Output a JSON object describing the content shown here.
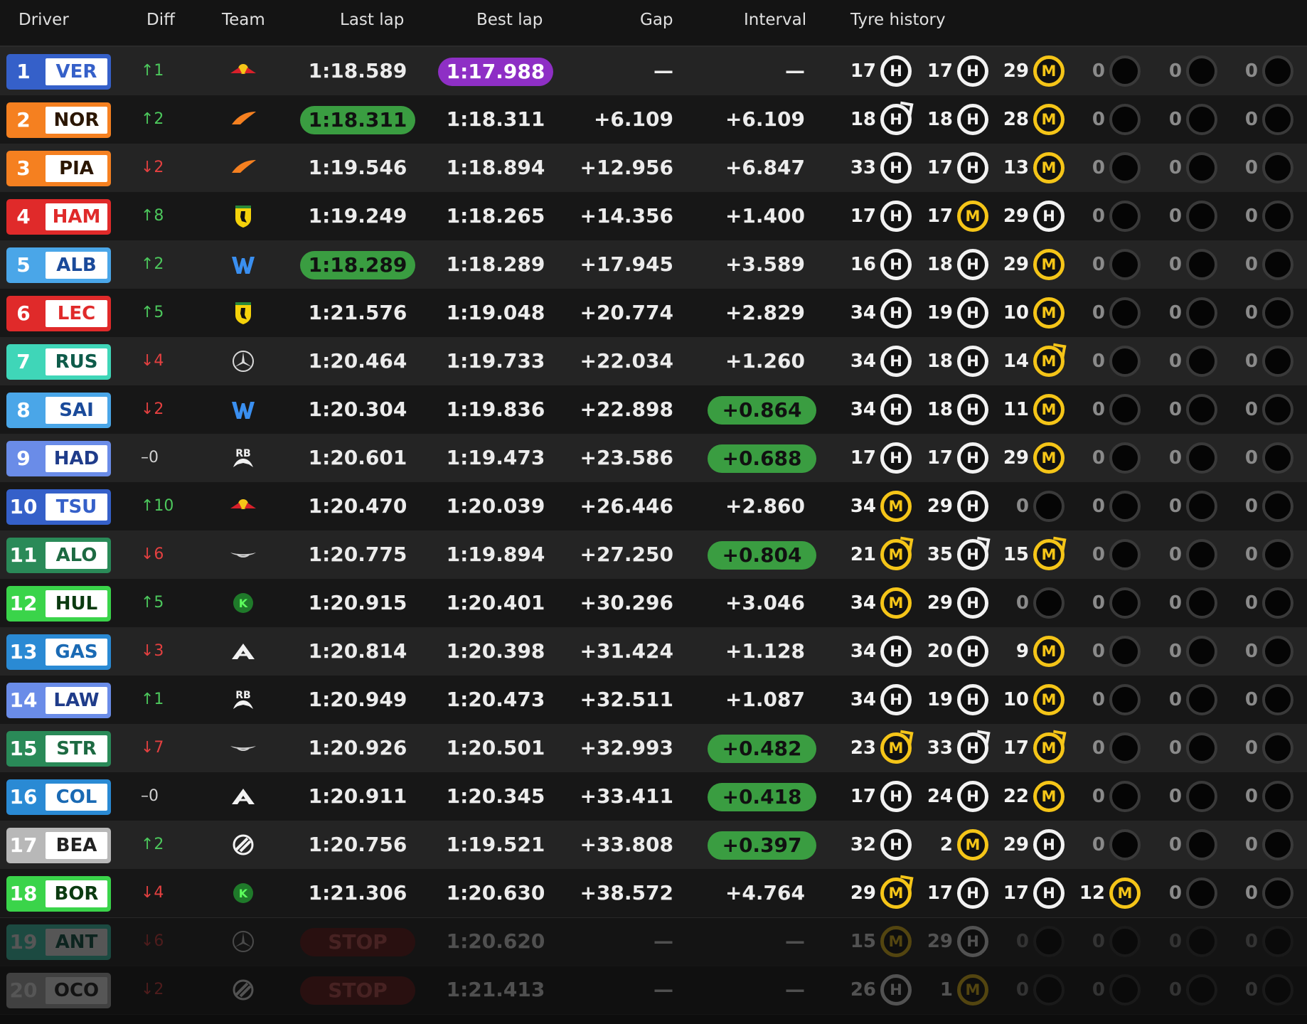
{
  "headers": {
    "driver": "Driver",
    "diff": "Diff",
    "team": "Team",
    "last_lap": "Last lap",
    "best_lap": "Best lap",
    "gap": "Gap",
    "interval": "Interval",
    "tyres": "Tyre history"
  },
  "colors": {
    "purple": "#8e2fc5",
    "green": "#3a9d41",
    "stop": "#6b1a18",
    "up": "#4cc75c",
    "down": "#e44040"
  },
  "rows": [
    {
      "pos": "1",
      "abbr": "VER",
      "team_color": "#3560c9",
      "abbr_color": "#3560c9",
      "diff": "↑1",
      "dir": "up",
      "team_icon": "redbull-icon",
      "last": "1:18.589",
      "last_hl": "",
      "best": "1:17.988",
      "best_hl": "purple",
      "gap": "—",
      "interval": "—",
      "int_hl": "",
      "tyres": [
        [
          "17",
          "H",
          ""
        ],
        [
          "17",
          "H",
          ""
        ],
        [
          "29",
          "M",
          ""
        ],
        [
          "0",
          "E",
          ""
        ],
        [
          "0",
          "E",
          ""
        ],
        [
          "0",
          "E",
          ""
        ]
      ]
    },
    {
      "pos": "2",
      "abbr": "NOR",
      "team_color": "#f58020",
      "abbr_color": "#2b1600",
      "diff": "↑2",
      "dir": "up",
      "team_icon": "mclaren-icon",
      "last": "1:18.311",
      "last_hl": "green",
      "best": "1:18.311",
      "best_hl": "",
      "gap": "+6.109",
      "interval": "+6.109",
      "int_hl": "",
      "tyres": [
        [
          "18",
          "H",
          "used"
        ],
        [
          "18",
          "H",
          ""
        ],
        [
          "28",
          "M",
          ""
        ],
        [
          "0",
          "E",
          ""
        ],
        [
          "0",
          "E",
          ""
        ],
        [
          "0",
          "E",
          ""
        ]
      ]
    },
    {
      "pos": "3",
      "abbr": "PIA",
      "team_color": "#f58020",
      "abbr_color": "#2b1600",
      "diff": "↓2",
      "dir": "down",
      "team_icon": "mclaren-icon",
      "last": "1:19.546",
      "last_hl": "",
      "best": "1:18.894",
      "best_hl": "",
      "gap": "+12.956",
      "interval": "+6.847",
      "int_hl": "",
      "tyres": [
        [
          "33",
          "H",
          ""
        ],
        [
          "17",
          "H",
          ""
        ],
        [
          "13",
          "M",
          ""
        ],
        [
          "0",
          "E",
          ""
        ],
        [
          "0",
          "E",
          ""
        ],
        [
          "0",
          "E",
          ""
        ]
      ]
    },
    {
      "pos": "4",
      "abbr": "HAM",
      "team_color": "#e02a2a",
      "abbr_color": "#e02a2a",
      "diff": "↑8",
      "dir": "up",
      "team_icon": "ferrari-icon",
      "last": "1:19.249",
      "last_hl": "",
      "best": "1:18.265",
      "best_hl": "",
      "gap": "+14.356",
      "interval": "+1.400",
      "int_hl": "",
      "tyres": [
        [
          "17",
          "H",
          ""
        ],
        [
          "17",
          "M",
          ""
        ],
        [
          "29",
          "H",
          ""
        ],
        [
          "0",
          "E",
          ""
        ],
        [
          "0",
          "E",
          ""
        ],
        [
          "0",
          "E",
          ""
        ]
      ]
    },
    {
      "pos": "5",
      "abbr": "ALB",
      "team_color": "#4aa6e8",
      "abbr_color": "#1a4a9a",
      "diff": "↑2",
      "dir": "up",
      "team_icon": "williams-icon",
      "last": "1:18.289",
      "last_hl": "green",
      "best": "1:18.289",
      "best_hl": "",
      "gap": "+17.945",
      "interval": "+3.589",
      "int_hl": "",
      "tyres": [
        [
          "16",
          "H",
          ""
        ],
        [
          "18",
          "H",
          ""
        ],
        [
          "29",
          "M",
          ""
        ],
        [
          "0",
          "E",
          ""
        ],
        [
          "0",
          "E",
          ""
        ],
        [
          "0",
          "E",
          ""
        ]
      ]
    },
    {
      "pos": "6",
      "abbr": "LEC",
      "team_color": "#e02a2a",
      "abbr_color": "#e02a2a",
      "diff": "↑5",
      "dir": "up",
      "team_icon": "ferrari-icon",
      "last": "1:21.576",
      "last_hl": "",
      "best": "1:19.048",
      "best_hl": "",
      "gap": "+20.774",
      "interval": "+2.829",
      "int_hl": "",
      "tyres": [
        [
          "34",
          "H",
          ""
        ],
        [
          "19",
          "H",
          ""
        ],
        [
          "10",
          "M",
          ""
        ],
        [
          "0",
          "E",
          ""
        ],
        [
          "0",
          "E",
          ""
        ],
        [
          "0",
          "E",
          ""
        ]
      ]
    },
    {
      "pos": "7",
      "abbr": "RUS",
      "team_color": "#3fd6b8",
      "abbr_color": "#0e5b4a",
      "diff": "↓4",
      "dir": "down",
      "team_icon": "mercedes-icon",
      "last": "1:20.464",
      "last_hl": "",
      "best": "1:19.733",
      "best_hl": "",
      "gap": "+22.034",
      "interval": "+1.260",
      "int_hl": "",
      "tyres": [
        [
          "34",
          "H",
          ""
        ],
        [
          "18",
          "H",
          ""
        ],
        [
          "14",
          "M",
          "used"
        ],
        [
          "0",
          "E",
          ""
        ],
        [
          "0",
          "E",
          ""
        ],
        [
          "0",
          "E",
          ""
        ]
      ]
    },
    {
      "pos": "8",
      "abbr": "SAI",
      "team_color": "#4aa6e8",
      "abbr_color": "#1a4a9a",
      "diff": "↓2",
      "dir": "down",
      "team_icon": "williams-icon",
      "last": "1:20.304",
      "last_hl": "",
      "best": "1:19.836",
      "best_hl": "",
      "gap": "+22.898",
      "interval": "+0.864",
      "int_hl": "green",
      "tyres": [
        [
          "34",
          "H",
          ""
        ],
        [
          "18",
          "H",
          ""
        ],
        [
          "11",
          "M",
          ""
        ],
        [
          "0",
          "E",
          ""
        ],
        [
          "0",
          "E",
          ""
        ],
        [
          "0",
          "E",
          ""
        ]
      ]
    },
    {
      "pos": "9",
      "abbr": "HAD",
      "team_color": "#6a8ce8",
      "abbr_color": "#1f3c8a",
      "diff": "–0",
      "dir": "flat",
      "team_icon": "racingbulls-icon",
      "last": "1:20.601",
      "last_hl": "",
      "best": "1:19.473",
      "best_hl": "",
      "gap": "+23.586",
      "interval": "+0.688",
      "int_hl": "green",
      "tyres": [
        [
          "17",
          "H",
          ""
        ],
        [
          "17",
          "H",
          ""
        ],
        [
          "29",
          "M",
          ""
        ],
        [
          "0",
          "E",
          ""
        ],
        [
          "0",
          "E",
          ""
        ],
        [
          "0",
          "E",
          ""
        ]
      ]
    },
    {
      "pos": "10",
      "abbr": "TSU",
      "team_color": "#3560c9",
      "abbr_color": "#3560c9",
      "diff": "↑10",
      "dir": "up",
      "team_icon": "redbull-icon",
      "last": "1:20.470",
      "last_hl": "",
      "best": "1:20.039",
      "best_hl": "",
      "gap": "+26.446",
      "interval": "+2.860",
      "int_hl": "",
      "tyres": [
        [
          "34",
          "M",
          ""
        ],
        [
          "29",
          "H",
          ""
        ],
        [
          "0",
          "E",
          ""
        ],
        [
          "0",
          "E",
          ""
        ],
        [
          "0",
          "E",
          ""
        ],
        [
          "0",
          "E",
          ""
        ]
      ]
    },
    {
      "pos": "11",
      "abbr": "ALO",
      "team_color": "#2a8a58",
      "abbr_color": "#1d6a42",
      "diff": "↓6",
      "dir": "down",
      "team_icon": "astonmartin-icon",
      "last": "1:20.775",
      "last_hl": "",
      "best": "1:19.894",
      "best_hl": "",
      "gap": "+27.250",
      "interval": "+0.804",
      "int_hl": "green",
      "tyres": [
        [
          "21",
          "M",
          "used"
        ],
        [
          "35",
          "H",
          "used"
        ],
        [
          "15",
          "M",
          "used"
        ],
        [
          "0",
          "E",
          ""
        ],
        [
          "0",
          "E",
          ""
        ],
        [
          "0",
          "E",
          ""
        ]
      ]
    },
    {
      "pos": "12",
      "abbr": "HUL",
      "team_color": "#3ad44a",
      "abbr_color": "#0b3a10",
      "diff": "↑5",
      "dir": "up",
      "team_icon": "sauber-icon",
      "last": "1:20.915",
      "last_hl": "",
      "best": "1:20.401",
      "best_hl": "",
      "gap": "+30.296",
      "interval": "+3.046",
      "int_hl": "",
      "tyres": [
        [
          "34",
          "M",
          ""
        ],
        [
          "29",
          "H",
          ""
        ],
        [
          "0",
          "E",
          ""
        ],
        [
          "0",
          "E",
          ""
        ],
        [
          "0",
          "E",
          ""
        ],
        [
          "0",
          "E",
          ""
        ]
      ]
    },
    {
      "pos": "13",
      "abbr": "GAS",
      "team_color": "#2a8ad4",
      "abbr_color": "#1a6ab4",
      "diff": "↓3",
      "dir": "down",
      "team_icon": "alpine-icon",
      "last": "1:20.814",
      "last_hl": "",
      "best": "1:20.398",
      "best_hl": "",
      "gap": "+31.424",
      "interval": "+1.128",
      "int_hl": "",
      "tyres": [
        [
          "34",
          "H",
          ""
        ],
        [
          "20",
          "H",
          ""
        ],
        [
          "9",
          "M",
          ""
        ],
        [
          "0",
          "E",
          ""
        ],
        [
          "0",
          "E",
          ""
        ],
        [
          "0",
          "E",
          ""
        ]
      ]
    },
    {
      "pos": "14",
      "abbr": "LAW",
      "team_color": "#6a8ce8",
      "abbr_color": "#1f3c8a",
      "diff": "↑1",
      "dir": "up",
      "team_icon": "racingbulls-icon",
      "last": "1:20.949",
      "last_hl": "",
      "best": "1:20.473",
      "best_hl": "",
      "gap": "+32.511",
      "interval": "+1.087",
      "int_hl": "",
      "tyres": [
        [
          "34",
          "H",
          ""
        ],
        [
          "19",
          "H",
          ""
        ],
        [
          "10",
          "M",
          ""
        ],
        [
          "0",
          "E",
          ""
        ],
        [
          "0",
          "E",
          ""
        ],
        [
          "0",
          "E",
          ""
        ]
      ]
    },
    {
      "pos": "15",
      "abbr": "STR",
      "team_color": "#2a8a58",
      "abbr_color": "#1d6a42",
      "diff": "↓7",
      "dir": "down",
      "team_icon": "astonmartin-icon",
      "last": "1:20.926",
      "last_hl": "",
      "best": "1:20.501",
      "best_hl": "",
      "gap": "+32.993",
      "interval": "+0.482",
      "int_hl": "green",
      "tyres": [
        [
          "23",
          "M",
          "used"
        ],
        [
          "33",
          "H",
          "used"
        ],
        [
          "17",
          "M",
          "used"
        ],
        [
          "0",
          "E",
          ""
        ],
        [
          "0",
          "E",
          ""
        ],
        [
          "0",
          "E",
          ""
        ]
      ]
    },
    {
      "pos": "16",
      "abbr": "COL",
      "team_color": "#2a8ad4",
      "abbr_color": "#1a6ab4",
      "diff": "–0",
      "dir": "flat",
      "team_icon": "alpine-icon",
      "last": "1:20.911",
      "last_hl": "",
      "best": "1:20.345",
      "best_hl": "",
      "gap": "+33.411",
      "interval": "+0.418",
      "int_hl": "green",
      "tyres": [
        [
          "17",
          "H",
          ""
        ],
        [
          "24",
          "H",
          ""
        ],
        [
          "22",
          "M",
          ""
        ],
        [
          "0",
          "E",
          ""
        ],
        [
          "0",
          "E",
          ""
        ],
        [
          "0",
          "E",
          ""
        ]
      ]
    },
    {
      "pos": "17",
      "abbr": "BEA",
      "team_color": "#b8b8b8",
      "abbr_color": "#222222",
      "diff": "↑2",
      "dir": "up",
      "team_icon": "haas-icon",
      "last": "1:20.756",
      "last_hl": "",
      "best": "1:19.521",
      "best_hl": "",
      "gap": "+33.808",
      "interval": "+0.397",
      "int_hl": "green",
      "tyres": [
        [
          "32",
          "H",
          ""
        ],
        [
          "2",
          "M",
          ""
        ],
        [
          "29",
          "H",
          ""
        ],
        [
          "0",
          "E",
          ""
        ],
        [
          "0",
          "E",
          ""
        ],
        [
          "0",
          "E",
          ""
        ]
      ]
    },
    {
      "pos": "18",
      "abbr": "BOR",
      "team_color": "#3ad44a",
      "abbr_color": "#0b3a10",
      "diff": "↓4",
      "dir": "down",
      "team_icon": "sauber-icon",
      "last": "1:21.306",
      "last_hl": "",
      "best": "1:20.630",
      "best_hl": "",
      "gap": "+38.572",
      "interval": "+4.764",
      "int_hl": "",
      "tyres": [
        [
          "29",
          "M",
          "used"
        ],
        [
          "17",
          "H",
          ""
        ],
        [
          "17",
          "H",
          ""
        ],
        [
          "12",
          "M",
          ""
        ],
        [
          "0",
          "E",
          ""
        ],
        [
          "0",
          "E",
          ""
        ]
      ]
    },
    {
      "pos": "19",
      "abbr": "ANT",
      "team_color": "#3fd6b8",
      "abbr_color": "#0e5b4a",
      "diff": "↓6",
      "dir": "down",
      "team_icon": "mercedes-icon",
      "last": "STOP",
      "last_hl": "stop",
      "best": "1:20.620",
      "best_hl": "",
      "gap": "—",
      "interval": "—",
      "int_hl": "",
      "out": true,
      "tyres": [
        [
          "15",
          "M",
          ""
        ],
        [
          "29",
          "H",
          ""
        ],
        [
          "0",
          "E",
          ""
        ],
        [
          "0",
          "E",
          ""
        ],
        [
          "0",
          "E",
          ""
        ],
        [
          "0",
          "E",
          ""
        ]
      ]
    },
    {
      "pos": "20",
      "abbr": "OCO",
      "team_color": "#b8b8b8",
      "abbr_color": "#222222",
      "diff": "↓2",
      "dir": "down",
      "team_icon": "haas-icon",
      "last": "STOP",
      "last_hl": "stop",
      "best": "1:21.413",
      "best_hl": "",
      "gap": "—",
      "interval": "—",
      "int_hl": "",
      "out": true,
      "tyres": [
        [
          "26",
          "H",
          ""
        ],
        [
          "1",
          "M",
          ""
        ],
        [
          "0",
          "E",
          ""
        ],
        [
          "0",
          "E",
          ""
        ],
        [
          "0",
          "E",
          ""
        ],
        [
          "0",
          "E",
          ""
        ]
      ]
    }
  ]
}
